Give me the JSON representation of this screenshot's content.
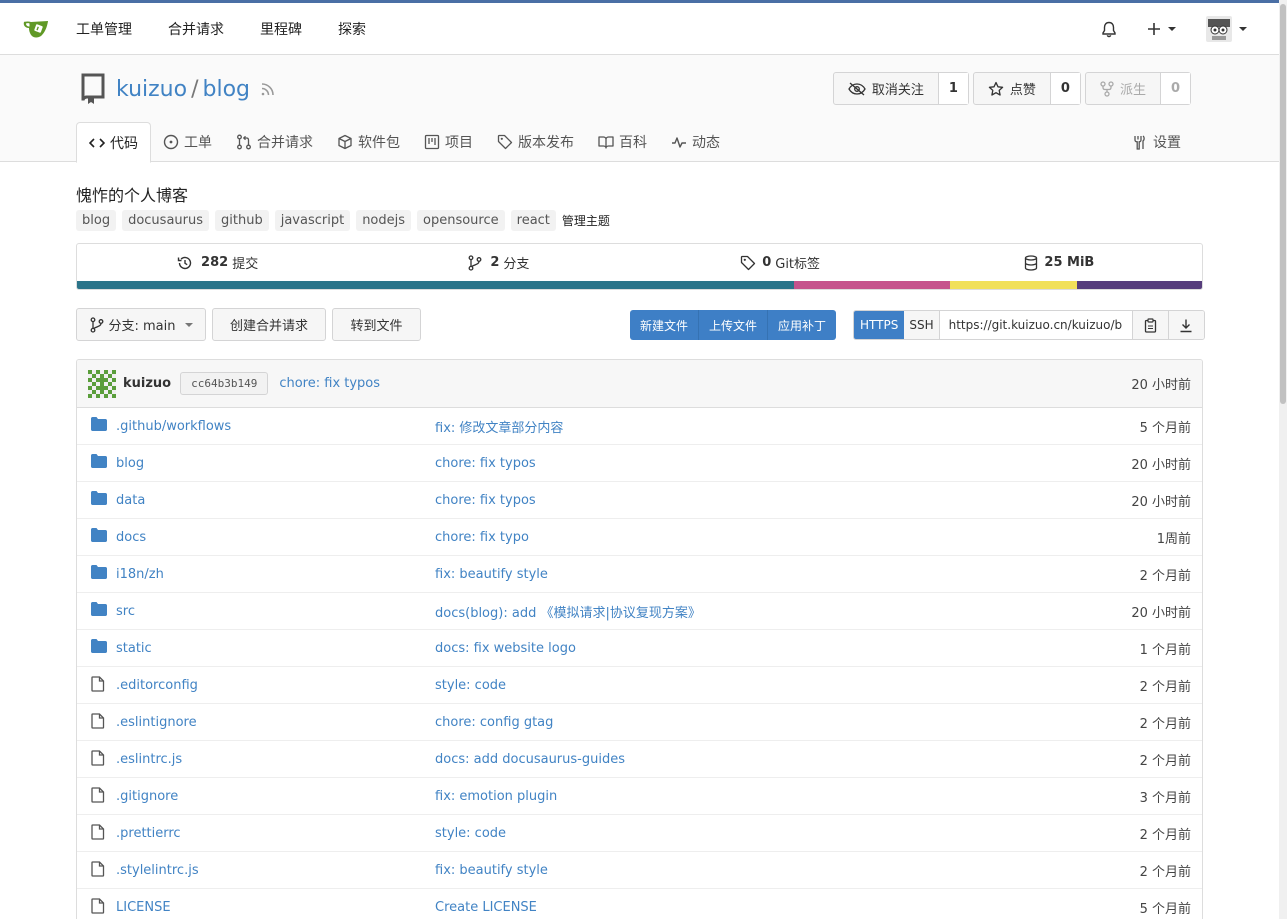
{
  "nav": {
    "items": [
      "工单管理",
      "合并请求",
      "里程碑",
      "探索"
    ]
  },
  "repo": {
    "owner": "kuizuo",
    "name": "blog",
    "watch_label": "取消关注",
    "watch_count": "1",
    "star_label": "点赞",
    "star_count": "0",
    "fork_label": "派生",
    "fork_count": "0"
  },
  "tabs": [
    {
      "label": "代码",
      "icon": "code-icon"
    },
    {
      "label": "工单",
      "icon": "issue-icon"
    },
    {
      "label": "合并请求",
      "icon": "pull-request-icon"
    },
    {
      "label": "软件包",
      "icon": "package-icon"
    },
    {
      "label": "项目",
      "icon": "project-icon"
    },
    {
      "label": "版本发布",
      "icon": "tag-icon"
    },
    {
      "label": "百科",
      "icon": "book-icon"
    },
    {
      "label": "动态",
      "icon": "pulse-icon"
    }
  ],
  "settings_label": "设置",
  "description": "愧怍的个人博客",
  "topics": [
    "blog",
    "docusaurus",
    "github",
    "javascript",
    "nodejs",
    "opensource",
    "react"
  ],
  "manage_topics": "管理主题",
  "stats": {
    "commits_count": "282",
    "commits_label": "提交",
    "branches_count": "2",
    "branches_label": "分支",
    "tags_count": "0",
    "tags_label": "Git标签",
    "size": "25 MiB"
  },
  "languages": [
    {
      "color": "#2b7489",
      "share": 63.7
    },
    {
      "color": "#c6538c",
      "share": 13.9
    },
    {
      "color": "#f1e05a",
      "share": 11.3
    },
    {
      "color": "#563d7c",
      "share": 11.1
    }
  ],
  "toolbar": {
    "branch_label": "分支: main",
    "new_pr": "创建合并请求",
    "goto_file": "转到文件",
    "new_file": "新建文件",
    "upload_file": "上传文件",
    "apply_patch": "应用补丁",
    "https": "HTTPS",
    "ssh": "SSH",
    "clone_url": "https://git.kuizuo.cn/kuizuo/blog.git"
  },
  "latest_commit": {
    "author": "kuizuo",
    "sha": "cc64b3b149",
    "message": "chore: fix typos",
    "time": "20 小时前"
  },
  "files": [
    {
      "type": "dir",
      "name": ".github/workflows",
      "message": "fix: 修改文章部分内容",
      "time": "5 个月前"
    },
    {
      "type": "dir",
      "name": "blog",
      "message": "chore: fix typos",
      "time": "20 小时前"
    },
    {
      "type": "dir",
      "name": "data",
      "message": "chore: fix typos",
      "time": "20 小时前"
    },
    {
      "type": "dir",
      "name": "docs",
      "message": "chore: fix typo",
      "time": "1周前"
    },
    {
      "type": "dir",
      "name": "i18n/zh",
      "message": "fix: beautify style",
      "time": "2 个月前"
    },
    {
      "type": "dir",
      "name": "src",
      "message": "docs(blog): add 《模拟请求|协议复现方案》",
      "time": "20 小时前"
    },
    {
      "type": "dir",
      "name": "static",
      "message": "docs: fix website logo",
      "time": "1 个月前"
    },
    {
      "type": "file",
      "name": ".editorconfig",
      "message": "style: code",
      "time": "2 个月前"
    },
    {
      "type": "file",
      "name": ".eslintignore",
      "message": "chore: config gtag",
      "time": "2 个月前"
    },
    {
      "type": "file",
      "name": ".eslintrc.js",
      "message": "docs: add docusaurus-guides",
      "time": "2 个月前"
    },
    {
      "type": "file",
      "name": ".gitignore",
      "message": "fix: emotion plugin",
      "time": "3 个月前"
    },
    {
      "type": "file",
      "name": ".prettierrc",
      "message": "style: code",
      "time": "2 个月前"
    },
    {
      "type": "file",
      "name": ".stylelintrc.js",
      "message": "fix: beautify style",
      "time": "2 个月前"
    },
    {
      "type": "file",
      "name": "LICENSE",
      "message": "Create LICENSE",
      "time": "5 个月前"
    }
  ],
  "colors": {
    "link": "#4183c4",
    "primary_button": "#3e7fc6",
    "folder_icon": "#4183c4"
  }
}
